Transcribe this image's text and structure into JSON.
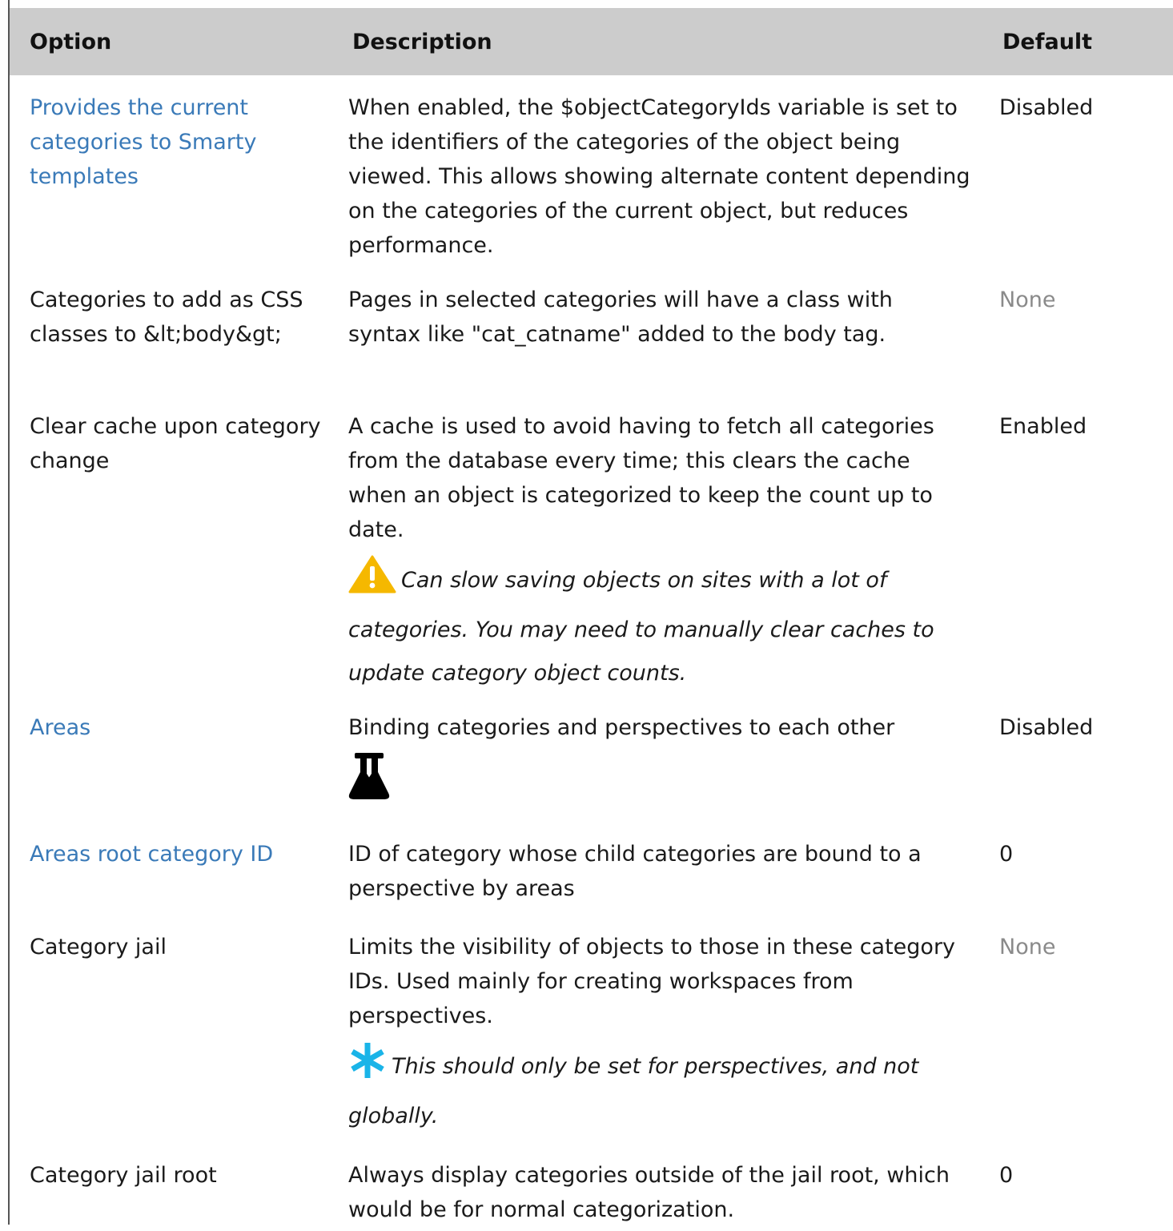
{
  "header": {
    "option": "Option",
    "description": "Description",
    "default": "Default"
  },
  "rows": [
    {
      "option": "Provides the current categories to Smarty templates",
      "option_is_link": true,
      "description": "When enabled, the $objectCategoryIds variable is set to the identifiers of the categories of the object being viewed. This allows showing alternate content depending on the categories of the current object, but reduces performance.",
      "default": "Disabled"
    },
    {
      "option": "Categories to add as CSS classes to &lt;body&gt;",
      "option_is_link": false,
      "description": "Pages in selected categories will have a class with syntax like \"cat_catname\" added to the body tag.",
      "default": "None",
      "default_muted": true
    },
    {
      "option": "Clear cache upon category change",
      "option_is_link": false,
      "description": "A cache is used to avoid having to fetch all categories from the database every time; this clears the cache when an object is categorized to keep the count up to date.",
      "note": "Can slow saving objects on sites with a lot of categories. You may need to manually clear caches to update category object counts.",
      "note_icon": "warning-icon",
      "default": "Enabled"
    },
    {
      "option": "Areas",
      "option_is_link": true,
      "description": "Binding categories and perspectives to each other",
      "extra_icon": "flask-icon",
      "default": "Disabled"
    },
    {
      "option": "Areas root category ID",
      "option_is_link": true,
      "description": "ID of category whose child categories are bound to a perspective by areas",
      "default": "0"
    },
    {
      "option": "Category jail",
      "option_is_link": false,
      "description": "Limits the visibility of objects to those in these category IDs. Used mainly for creating workspaces from perspectives.",
      "note": "This should only be set for perspectives, and not globally.",
      "note_icon": "asterisk-icon",
      "default": "None",
      "default_muted": true
    },
    {
      "option": "Category jail root",
      "option_is_link": false,
      "description": "Always display categories outside of the jail root, which would be for normal categorization.",
      "default": "0"
    }
  ],
  "colors": {
    "link": "#3a7ab8",
    "header_bg": "#cccccc",
    "warning": "#f5b800",
    "asterisk": "#1ab4e8",
    "muted": "#8a8a8a"
  }
}
